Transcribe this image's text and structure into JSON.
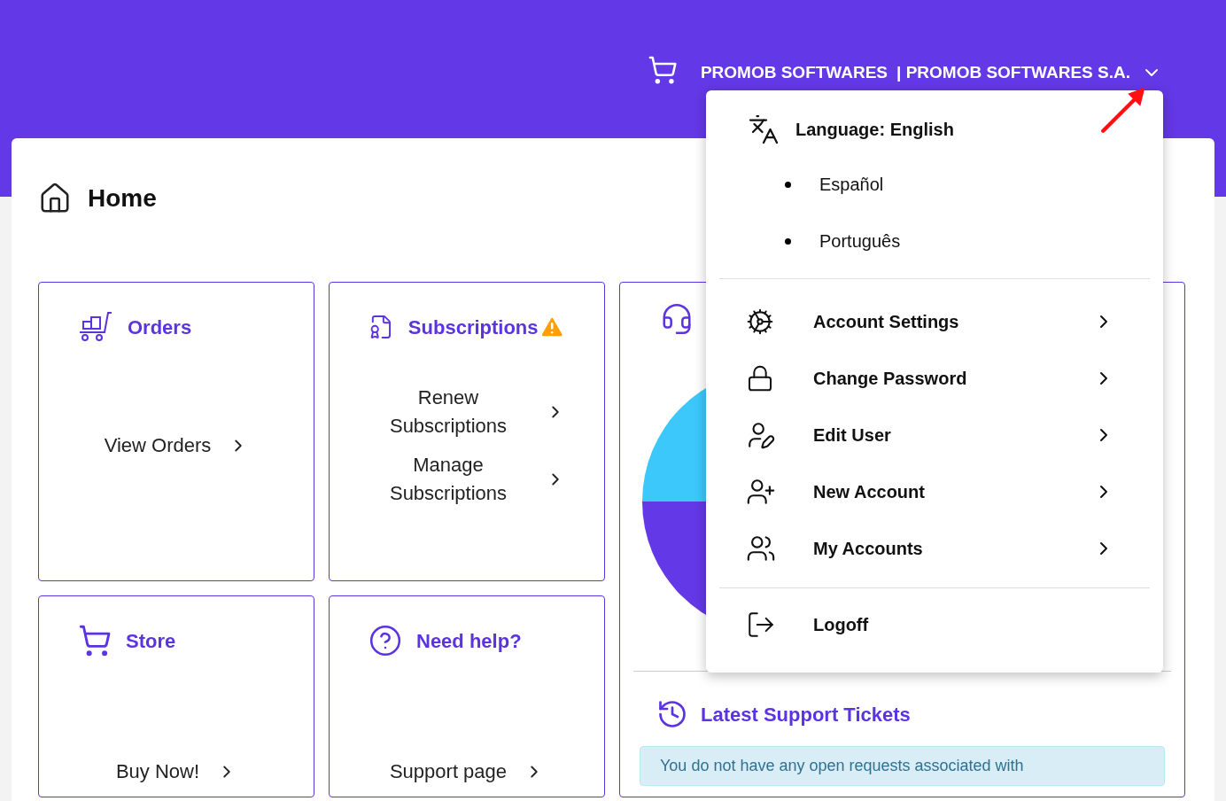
{
  "header": {
    "company": "PROMOB SOFTWARES",
    "account": "| PROMOB SOFTWARES S.A."
  },
  "page": {
    "title": "Home"
  },
  "cards": [
    {
      "kind": "orders",
      "title": "Orders",
      "warning": false,
      "links": [
        "View Orders"
      ]
    },
    {
      "kind": "subscriptions",
      "title": "Subscriptions",
      "warning": true,
      "links": [
        "Renew Subscriptions",
        "Manage Subscriptions"
      ]
    },
    {
      "kind": "store",
      "title": "Store",
      "warning": false,
      "links": [
        "Buy Now!"
      ]
    },
    {
      "kind": "help",
      "title": "Need help?",
      "warning": false,
      "links": [
        "Support page"
      ]
    }
  ],
  "support": {
    "tickets_title": "Latest Support Tickets",
    "notice": "You do not have any open requests associated with"
  },
  "menu": {
    "language": "Language: English",
    "languages": [
      "Español",
      "Português"
    ],
    "items": [
      {
        "kind": "settings",
        "label": "Account Settings"
      },
      {
        "kind": "password",
        "label": "Change Password"
      },
      {
        "kind": "edit",
        "label": "Edit User"
      },
      {
        "kind": "new",
        "label": "New Account"
      },
      {
        "kind": "accounts",
        "label": "My Accounts"
      }
    ],
    "logoff": "Logoff"
  }
}
